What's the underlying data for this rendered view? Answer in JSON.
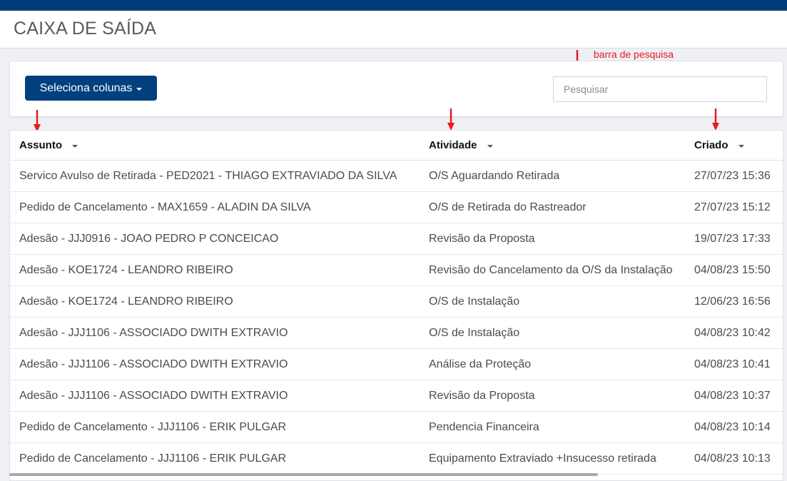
{
  "page": {
    "title": "CAIXA DE SAÍDA"
  },
  "toolbar": {
    "columns_button_label": "Seleciona colunas",
    "search_placeholder": "Pesquisar"
  },
  "annotations": {
    "search_bar_label": "barra de pesquisa"
  },
  "table": {
    "headers": [
      "Assunto",
      "Atividade",
      "Criado"
    ],
    "rows": [
      [
        "Servico Avulso de Retirada - PED2021 - THIAGO EXTRAVIADO DA SILVA",
        "O/S Aguardando Retirada",
        "27/07/23 15:36"
      ],
      [
        "Pedido de Cancelamento - MAX1659 - ALADIN DA SILVA",
        "O/S de Retirada do Rastreador",
        "27/07/23 15:12"
      ],
      [
        "Adesão - JJJ0916 - JOAO PEDRO P CONCEICAO",
        "Revisão da Proposta",
        "19/07/23 17:33"
      ],
      [
        "Adesão - KOE1724 - LEANDRO RIBEIRO",
        "Revisão do Cancelamento da O/S da Instalação",
        "04/08/23 15:50"
      ],
      [
        "Adesão - KOE1724 - LEANDRO RIBEIRO",
        "O/S de Instalação",
        "12/06/23 16:56"
      ],
      [
        "Adesão - JJJ1106 - ASSOCIADO DWITH EXTRAVIO",
        "O/S de Instalação",
        "04/08/23 10:42"
      ],
      [
        "Adesão - JJJ1106 - ASSOCIADO DWITH EXTRAVIO",
        "Análise da Proteção",
        "04/08/23 10:41"
      ],
      [
        "Adesão - JJJ1106 - ASSOCIADO DWITH EXTRAVIO",
        "Revisão da Proposta",
        "04/08/23 10:37"
      ],
      [
        "Pedido de Cancelamento - JJJ1106 - ERIK PULGAR",
        "Pendencia Financeira",
        "04/08/23 10:14"
      ],
      [
        "Pedido de Cancelamento - JJJ1106 - ERIK PULGAR",
        "Equipamento Extraviado +Insucesso retirada",
        "04/08/23 10:13"
      ]
    ]
  },
  "colors": {
    "topbar": "#003d7a",
    "primary_button": "#00407f",
    "annotation": "#e8191c"
  },
  "icons": {
    "sort": "caret-down-icon",
    "dropdown": "caret-down-icon",
    "annotation": "red-arrow-down-icon"
  }
}
